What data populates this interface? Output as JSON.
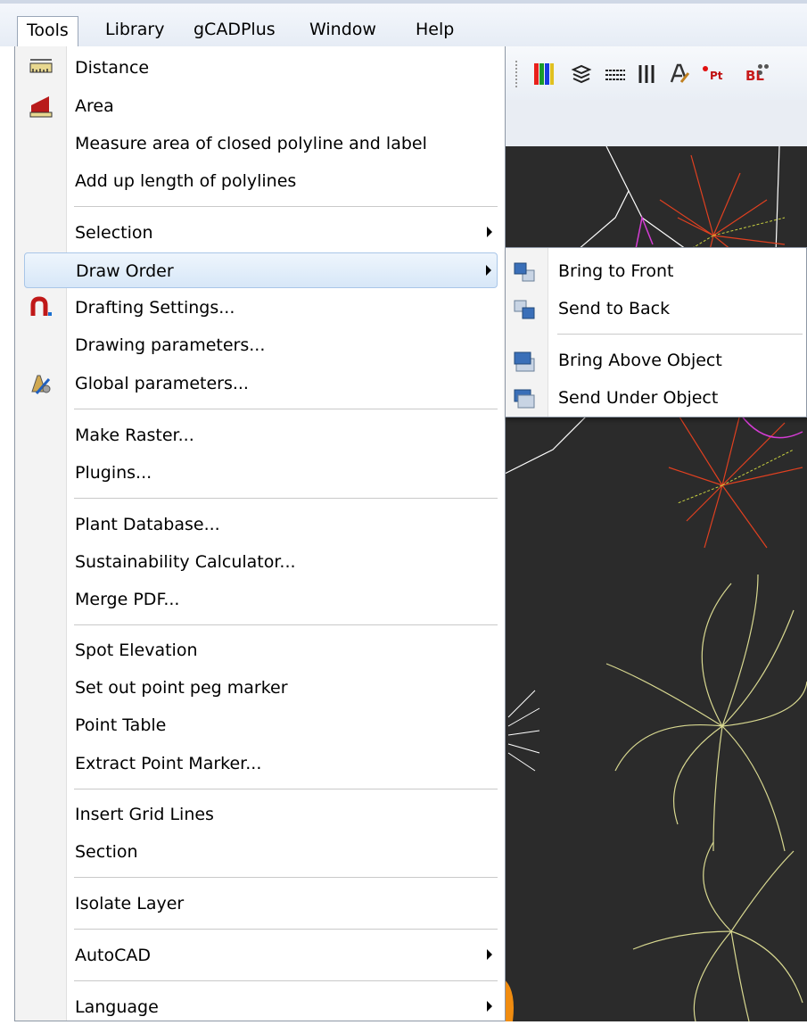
{
  "menubar": {
    "items": [
      {
        "label": "Tools",
        "active": true
      },
      {
        "label": "Library"
      },
      {
        "label": "gCADPlus"
      },
      {
        "label": "Window"
      },
      {
        "label": "Help"
      }
    ]
  },
  "toolbar": {
    "icons": [
      "color-bars-icon",
      "layers-icon",
      "linetype-icon",
      "columns-icon",
      "text-style-icon",
      "point-icon",
      "block-icon"
    ],
    "labels": {
      "point": "Pt",
      "block": "BL"
    }
  },
  "tools_menu": {
    "items": {
      "distance": "Distance",
      "area": "Area",
      "measure_area": "Measure area of closed polyline and label",
      "add_length": "Add up length of polylines",
      "selection": "Selection",
      "draw_order": "Draw Order",
      "drafting_settings": "Drafting Settings...",
      "drawing_parameters": "Drawing parameters...",
      "global_parameters": "Global parameters...",
      "make_raster": "Make Raster...",
      "plugins": "Plugins...",
      "plant_database": "Plant Database...",
      "sustainability": "Sustainability Calculator...",
      "merge_pdf": "Merge PDF...",
      "spot_elevation": "Spot Elevation",
      "set_out_point": "Set out point peg marker",
      "point_table": "Point Table",
      "extract_point": "Extract Point Marker...",
      "insert_grid": "Insert Grid Lines",
      "section": "Section",
      "isolate_layer": "Isolate Layer",
      "autocad": "AutoCAD",
      "language": "Language"
    }
  },
  "draw_order_submenu": {
    "bring_to_front": "Bring to Front",
    "send_to_back": "Send to Back",
    "bring_above": "Bring Above Object",
    "send_under": "Send Under Object"
  },
  "colors": {
    "highlight": "#d7e7f8",
    "canvas": "#2b2b2b",
    "drawing_yellow": "#d8d890",
    "drawing_magenta": "#d43cd4",
    "drawing_red": "#e04020",
    "drawing_orange": "#f08c10"
  }
}
